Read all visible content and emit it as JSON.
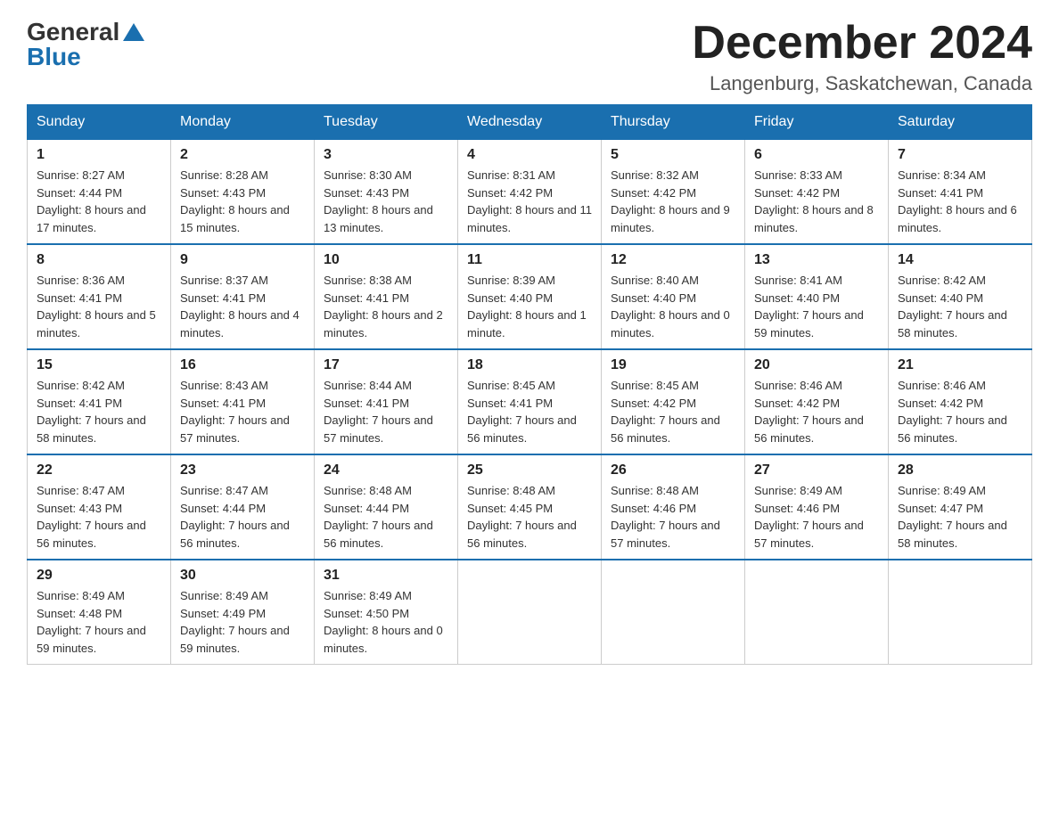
{
  "header": {
    "logo_general": "General",
    "logo_blue": "Blue",
    "month_title": "December 2024",
    "location": "Langenburg, Saskatchewan, Canada"
  },
  "weekdays": [
    "Sunday",
    "Monday",
    "Tuesday",
    "Wednesday",
    "Thursday",
    "Friday",
    "Saturday"
  ],
  "weeks": [
    [
      {
        "day": "1",
        "sunrise": "8:27 AM",
        "sunset": "4:44 PM",
        "daylight": "8 hours and 17 minutes."
      },
      {
        "day": "2",
        "sunrise": "8:28 AM",
        "sunset": "4:43 PM",
        "daylight": "8 hours and 15 minutes."
      },
      {
        "day": "3",
        "sunrise": "8:30 AM",
        "sunset": "4:43 PM",
        "daylight": "8 hours and 13 minutes."
      },
      {
        "day": "4",
        "sunrise": "8:31 AM",
        "sunset": "4:42 PM",
        "daylight": "8 hours and 11 minutes."
      },
      {
        "day": "5",
        "sunrise": "8:32 AM",
        "sunset": "4:42 PM",
        "daylight": "8 hours and 9 minutes."
      },
      {
        "day": "6",
        "sunrise": "8:33 AM",
        "sunset": "4:42 PM",
        "daylight": "8 hours and 8 minutes."
      },
      {
        "day": "7",
        "sunrise": "8:34 AM",
        "sunset": "4:41 PM",
        "daylight": "8 hours and 6 minutes."
      }
    ],
    [
      {
        "day": "8",
        "sunrise": "8:36 AM",
        "sunset": "4:41 PM",
        "daylight": "8 hours and 5 minutes."
      },
      {
        "day": "9",
        "sunrise": "8:37 AM",
        "sunset": "4:41 PM",
        "daylight": "8 hours and 4 minutes."
      },
      {
        "day": "10",
        "sunrise": "8:38 AM",
        "sunset": "4:41 PM",
        "daylight": "8 hours and 2 minutes."
      },
      {
        "day": "11",
        "sunrise": "8:39 AM",
        "sunset": "4:40 PM",
        "daylight": "8 hours and 1 minute."
      },
      {
        "day": "12",
        "sunrise": "8:40 AM",
        "sunset": "4:40 PM",
        "daylight": "8 hours and 0 minutes."
      },
      {
        "day": "13",
        "sunrise": "8:41 AM",
        "sunset": "4:40 PM",
        "daylight": "7 hours and 59 minutes."
      },
      {
        "day": "14",
        "sunrise": "8:42 AM",
        "sunset": "4:40 PM",
        "daylight": "7 hours and 58 minutes."
      }
    ],
    [
      {
        "day": "15",
        "sunrise": "8:42 AM",
        "sunset": "4:41 PM",
        "daylight": "7 hours and 58 minutes."
      },
      {
        "day": "16",
        "sunrise": "8:43 AM",
        "sunset": "4:41 PM",
        "daylight": "7 hours and 57 minutes."
      },
      {
        "day": "17",
        "sunrise": "8:44 AM",
        "sunset": "4:41 PM",
        "daylight": "7 hours and 57 minutes."
      },
      {
        "day": "18",
        "sunrise": "8:45 AM",
        "sunset": "4:41 PM",
        "daylight": "7 hours and 56 minutes."
      },
      {
        "day": "19",
        "sunrise": "8:45 AM",
        "sunset": "4:42 PM",
        "daylight": "7 hours and 56 minutes."
      },
      {
        "day": "20",
        "sunrise": "8:46 AM",
        "sunset": "4:42 PM",
        "daylight": "7 hours and 56 minutes."
      },
      {
        "day": "21",
        "sunrise": "8:46 AM",
        "sunset": "4:42 PM",
        "daylight": "7 hours and 56 minutes."
      }
    ],
    [
      {
        "day": "22",
        "sunrise": "8:47 AM",
        "sunset": "4:43 PM",
        "daylight": "7 hours and 56 minutes."
      },
      {
        "day": "23",
        "sunrise": "8:47 AM",
        "sunset": "4:44 PM",
        "daylight": "7 hours and 56 minutes."
      },
      {
        "day": "24",
        "sunrise": "8:48 AM",
        "sunset": "4:44 PM",
        "daylight": "7 hours and 56 minutes."
      },
      {
        "day": "25",
        "sunrise": "8:48 AM",
        "sunset": "4:45 PM",
        "daylight": "7 hours and 56 minutes."
      },
      {
        "day": "26",
        "sunrise": "8:48 AM",
        "sunset": "4:46 PM",
        "daylight": "7 hours and 57 minutes."
      },
      {
        "day": "27",
        "sunrise": "8:49 AM",
        "sunset": "4:46 PM",
        "daylight": "7 hours and 57 minutes."
      },
      {
        "day": "28",
        "sunrise": "8:49 AM",
        "sunset": "4:47 PM",
        "daylight": "7 hours and 58 minutes."
      }
    ],
    [
      {
        "day": "29",
        "sunrise": "8:49 AM",
        "sunset": "4:48 PM",
        "daylight": "7 hours and 59 minutes."
      },
      {
        "day": "30",
        "sunrise": "8:49 AM",
        "sunset": "4:49 PM",
        "daylight": "7 hours and 59 minutes."
      },
      {
        "day": "31",
        "sunrise": "8:49 AM",
        "sunset": "4:50 PM",
        "daylight": "8 hours and 0 minutes."
      },
      null,
      null,
      null,
      null
    ]
  ],
  "labels": {
    "sunrise": "Sunrise:",
    "sunset": "Sunset:",
    "daylight": "Daylight:"
  }
}
